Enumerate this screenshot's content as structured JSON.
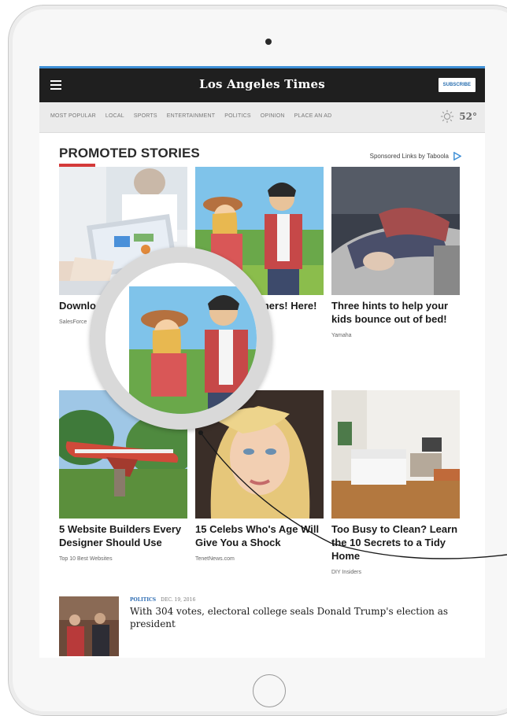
{
  "header": {
    "brand": "Los Angeles Times",
    "subscribe_label": "SUBSCRIBE"
  },
  "nav": {
    "items": [
      "MOST POPULAR",
      "LOCAL",
      "SPORTS",
      "ENTERTAINMENT",
      "POLITICS",
      "OPINION",
      "PLACE AN AD"
    ],
    "temperature": "52°"
  },
  "promoted": {
    "title": "PROMOTED STORIES",
    "sponsored_label": "Sponsored Links by Taboola",
    "cards": [
      {
        "headline": "Download Cloud Services",
        "source": "SalesForce"
      },
      {
        "headline": "Play With Farmers! Here!",
        "source": ""
      },
      {
        "headline": "Three hints to help your kids bounce out of bed!",
        "source": "Yamaha"
      },
      {
        "headline": "5 Website Builders Every Designer Should Use",
        "source": "Top 10 Best Websites"
      },
      {
        "headline": "15 Celebs Who's Age Will Give You a Shock",
        "source": "TenetNews.com"
      },
      {
        "headline": "Too Busy to Clean? Learn the 10 Secrets to a Tidy Home",
        "source": "DIY Insiders"
      }
    ]
  },
  "article": {
    "section": "POLITICS",
    "date": "DEC. 19, 2016",
    "title": "With 304 votes, electoral college seals Donald Trump's election as president"
  },
  "colors": {
    "topbar": "#1f1f1f",
    "accent_blue": "#3e8fd6",
    "underline_red": "#d43a3a",
    "nav_bg": "#ebebeb"
  }
}
